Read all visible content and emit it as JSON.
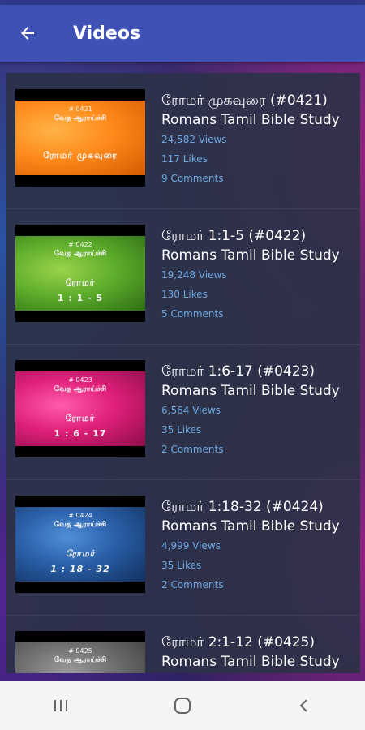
{
  "app_bar": {
    "title": "Videos",
    "back_icon": "arrow-back-icon"
  },
  "colors": {
    "app_bar": "#3f51b5",
    "meta_text": "#6ea8e0"
  },
  "videos": [
    {
      "title_line1": "ரோமர் முகவுரை (#0421)",
      "title_line2": "Romans Tamil Bible Study",
      "views": "24,582 Views",
      "likes": "117 Likes",
      "comments": "9 Comments",
      "thumb_number": "# 0421",
      "thumb_sub": "வேத ஆராய்ச்சி",
      "thumb_title": "ரோமர் முகவுரை",
      "thumb_color": "orange"
    },
    {
      "title_line1": "ரோமர் 1:1-5 (#0422)",
      "title_line2": "Romans Tamil Bible Study",
      "views": "19,248 Views",
      "likes": "130 Likes",
      "comments": "5 Comments",
      "thumb_number": "# 0422",
      "thumb_sub": "வேத ஆராய்ச்சி",
      "thumb_title": "ரோமர்\n1 : 1 - 5",
      "thumb_color": "green"
    },
    {
      "title_line1": "ரோமர் 1:6-17 (#0423)",
      "title_line2": "Romans Tamil Bible Study",
      "views": "6,564 Views",
      "likes": "35 Likes",
      "comments": "2 Comments",
      "thumb_number": "# 0423",
      "thumb_sub": "வேத ஆராய்ச்சி",
      "thumb_title": "ரோமர்\n1 : 6 - 17",
      "thumb_color": "pink"
    },
    {
      "title_line1": "ரோமர் 1:18-32 (#0424)",
      "title_line2": "Romans Tamil Bible Study",
      "views": "4,999 Views",
      "likes": "35 Likes",
      "comments": "2 Comments",
      "thumb_number": "# 0424",
      "thumb_sub": "வேத ஆராய்ச்சி",
      "thumb_title": "ரோமர்\n1 : 18 - 32",
      "thumb_color": "blue"
    },
    {
      "title_line1": "ரோமர் 2:1-12 (#0425)",
      "title_line2": "Romans Tamil Bible Study",
      "thumb_number": "# 0425",
      "thumb_sub": "வேத ஆராய்ச்சி",
      "thumb_color": "gray"
    }
  ],
  "nav_bar": {
    "recents_icon": "recent-apps-icon",
    "home_icon": "home-icon",
    "back_icon": "back-chevron-icon"
  }
}
